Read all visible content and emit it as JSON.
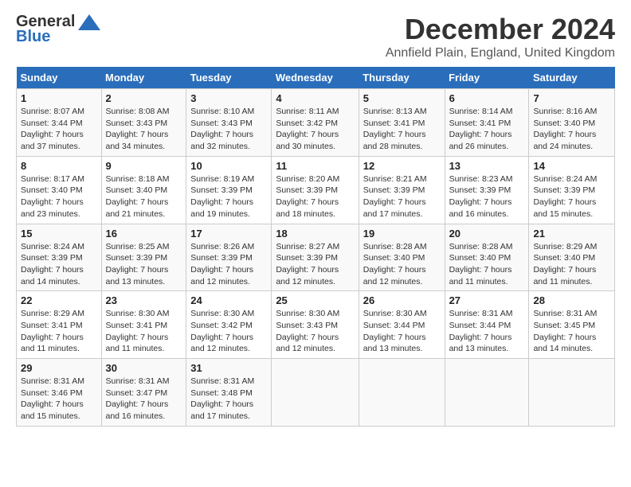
{
  "logo": {
    "line1": "General",
    "line2": "Blue"
  },
  "title": "December 2024",
  "subtitle": "Annfield Plain, England, United Kingdom",
  "days_of_week": [
    "Sunday",
    "Monday",
    "Tuesday",
    "Wednesday",
    "Thursday",
    "Friday",
    "Saturday"
  ],
  "weeks": [
    [
      {
        "day": "1",
        "info": "Sunrise: 8:07 AM\nSunset: 3:44 PM\nDaylight: 7 hours\nand 37 minutes."
      },
      {
        "day": "2",
        "info": "Sunrise: 8:08 AM\nSunset: 3:43 PM\nDaylight: 7 hours\nand 34 minutes."
      },
      {
        "day": "3",
        "info": "Sunrise: 8:10 AM\nSunset: 3:43 PM\nDaylight: 7 hours\nand 32 minutes."
      },
      {
        "day": "4",
        "info": "Sunrise: 8:11 AM\nSunset: 3:42 PM\nDaylight: 7 hours\nand 30 minutes."
      },
      {
        "day": "5",
        "info": "Sunrise: 8:13 AM\nSunset: 3:41 PM\nDaylight: 7 hours\nand 28 minutes."
      },
      {
        "day": "6",
        "info": "Sunrise: 8:14 AM\nSunset: 3:41 PM\nDaylight: 7 hours\nand 26 minutes."
      },
      {
        "day": "7",
        "info": "Sunrise: 8:16 AM\nSunset: 3:40 PM\nDaylight: 7 hours\nand 24 minutes."
      }
    ],
    [
      {
        "day": "8",
        "info": "Sunrise: 8:17 AM\nSunset: 3:40 PM\nDaylight: 7 hours\nand 23 minutes."
      },
      {
        "day": "9",
        "info": "Sunrise: 8:18 AM\nSunset: 3:40 PM\nDaylight: 7 hours\nand 21 minutes."
      },
      {
        "day": "10",
        "info": "Sunrise: 8:19 AM\nSunset: 3:39 PM\nDaylight: 7 hours\nand 19 minutes."
      },
      {
        "day": "11",
        "info": "Sunrise: 8:20 AM\nSunset: 3:39 PM\nDaylight: 7 hours\nand 18 minutes."
      },
      {
        "day": "12",
        "info": "Sunrise: 8:21 AM\nSunset: 3:39 PM\nDaylight: 7 hours\nand 17 minutes."
      },
      {
        "day": "13",
        "info": "Sunrise: 8:23 AM\nSunset: 3:39 PM\nDaylight: 7 hours\nand 16 minutes."
      },
      {
        "day": "14",
        "info": "Sunrise: 8:24 AM\nSunset: 3:39 PM\nDaylight: 7 hours\nand 15 minutes."
      }
    ],
    [
      {
        "day": "15",
        "info": "Sunrise: 8:24 AM\nSunset: 3:39 PM\nDaylight: 7 hours\nand 14 minutes."
      },
      {
        "day": "16",
        "info": "Sunrise: 8:25 AM\nSunset: 3:39 PM\nDaylight: 7 hours\nand 13 minutes."
      },
      {
        "day": "17",
        "info": "Sunrise: 8:26 AM\nSunset: 3:39 PM\nDaylight: 7 hours\nand 12 minutes."
      },
      {
        "day": "18",
        "info": "Sunrise: 8:27 AM\nSunset: 3:39 PM\nDaylight: 7 hours\nand 12 minutes."
      },
      {
        "day": "19",
        "info": "Sunrise: 8:28 AM\nSunset: 3:40 PM\nDaylight: 7 hours\nand 12 minutes."
      },
      {
        "day": "20",
        "info": "Sunrise: 8:28 AM\nSunset: 3:40 PM\nDaylight: 7 hours\nand 11 minutes."
      },
      {
        "day": "21",
        "info": "Sunrise: 8:29 AM\nSunset: 3:40 PM\nDaylight: 7 hours\nand 11 minutes."
      }
    ],
    [
      {
        "day": "22",
        "info": "Sunrise: 8:29 AM\nSunset: 3:41 PM\nDaylight: 7 hours\nand 11 minutes."
      },
      {
        "day": "23",
        "info": "Sunrise: 8:30 AM\nSunset: 3:41 PM\nDaylight: 7 hours\nand 11 minutes."
      },
      {
        "day": "24",
        "info": "Sunrise: 8:30 AM\nSunset: 3:42 PM\nDaylight: 7 hours\nand 12 minutes."
      },
      {
        "day": "25",
        "info": "Sunrise: 8:30 AM\nSunset: 3:43 PM\nDaylight: 7 hours\nand 12 minutes."
      },
      {
        "day": "26",
        "info": "Sunrise: 8:30 AM\nSunset: 3:44 PM\nDaylight: 7 hours\nand 13 minutes."
      },
      {
        "day": "27",
        "info": "Sunrise: 8:31 AM\nSunset: 3:44 PM\nDaylight: 7 hours\nand 13 minutes."
      },
      {
        "day": "28",
        "info": "Sunrise: 8:31 AM\nSunset: 3:45 PM\nDaylight: 7 hours\nand 14 minutes."
      }
    ],
    [
      {
        "day": "29",
        "info": "Sunrise: 8:31 AM\nSunset: 3:46 PM\nDaylight: 7 hours\nand 15 minutes."
      },
      {
        "day": "30",
        "info": "Sunrise: 8:31 AM\nSunset: 3:47 PM\nDaylight: 7 hours\nand 16 minutes."
      },
      {
        "day": "31",
        "info": "Sunrise: 8:31 AM\nSunset: 3:48 PM\nDaylight: 7 hours\nand 17 minutes."
      },
      null,
      null,
      null,
      null
    ]
  ]
}
